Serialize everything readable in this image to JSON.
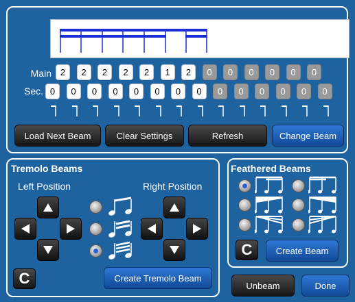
{
  "top": {
    "main_label": "Main",
    "sec_label": "Sec.",
    "main_values": [
      {
        "v": "2",
        "on": true
      },
      {
        "v": "2",
        "on": true
      },
      {
        "v": "2",
        "on": true
      },
      {
        "v": "2",
        "on": true
      },
      {
        "v": "2",
        "on": true
      },
      {
        "v": "1",
        "on": true
      },
      {
        "v": "2",
        "on": true
      },
      {
        "v": "0",
        "on": false
      },
      {
        "v": "0",
        "on": false
      },
      {
        "v": "0",
        "on": false
      },
      {
        "v": "0",
        "on": false
      },
      {
        "v": "0",
        "on": false
      },
      {
        "v": "0",
        "on": false
      }
    ],
    "sec_values": [
      {
        "v": "0",
        "on": true
      },
      {
        "v": "0",
        "on": true
      },
      {
        "v": "0",
        "on": true
      },
      {
        "v": "0",
        "on": true
      },
      {
        "v": "0",
        "on": true
      },
      {
        "v": "0",
        "on": true
      },
      {
        "v": "0",
        "on": true
      },
      {
        "v": "0",
        "on": true
      },
      {
        "v": "0",
        "on": false
      },
      {
        "v": "0",
        "on": false
      },
      {
        "v": "0",
        "on": false
      },
      {
        "v": "0",
        "on": false
      },
      {
        "v": "0",
        "on": false
      },
      {
        "v": "0",
        "on": false
      }
    ],
    "buttons": {
      "load_next": "Load Next Beam",
      "clear": "Clear Settings",
      "refresh": "Refresh",
      "change": "Change Beam"
    }
  },
  "tremolo": {
    "title": "Tremolo Beams",
    "left_label": "Left Position",
    "right_label": "Right Position",
    "create": "Create Tremolo Beam",
    "clear": "C",
    "selected_option": 3
  },
  "feathered": {
    "title": "Feathered Beams",
    "create": "Create Beam",
    "clear": "C",
    "selected_option": 1
  },
  "footer": {
    "unbeam": "Unbeam",
    "done": "Done"
  },
  "colors": {
    "background": "#1f62a0",
    "beam": "#1a2fd6",
    "accent_button": "#1c5fb8"
  }
}
